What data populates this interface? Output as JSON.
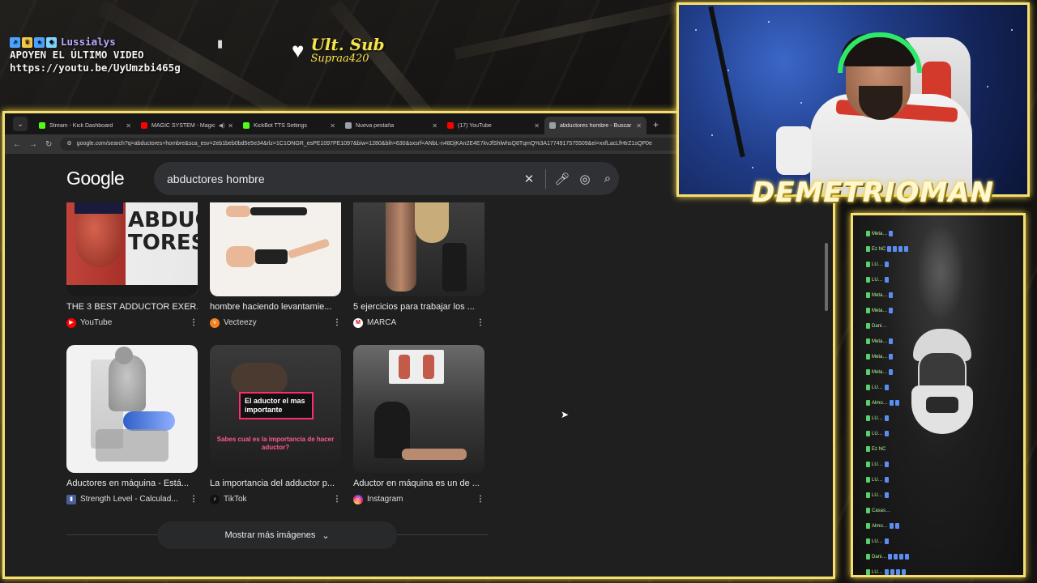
{
  "overlay": {
    "username": "Lussialys",
    "line1": "APOYEN EL ÚLTIMO VIDEO",
    "line2": "https://youtu.be/UyUmzbi465g",
    "sub_title": "Ult. Sub",
    "sub_name": "Supraa420"
  },
  "browser": {
    "tabs": [
      {
        "label": "Stream - Kick Dashboard",
        "color": "#53fc18"
      },
      {
        "label": "MAGIC SYSTEM - Magic In",
        "color": "#ff0000"
      },
      {
        "label": "KickBot TTS Settings",
        "color": "#53fc18"
      },
      {
        "label": "Nueva pestaña",
        "color": "#9aa0a6"
      },
      {
        "label": "(17) YouTube",
        "color": "#ff0000"
      },
      {
        "label": "abductores hombre - Buscar co",
        "color": "#9aa0a6"
      }
    ],
    "url": "google.com/search?q=abductores+hombre&sca_esv=2eb1beb0bd5e5e34&rlz=1C1ONGR_esPE1097PE1097&biw=1280&bih=630&sxsrf=ANbL-n48DjKAn2E4E7kvJfShlwhsQ8TqmQ%3A1774917575509&ei=xxfLacLfHtrZ1sQP0e"
  },
  "google": {
    "logo": "Google",
    "query": "abductores hombre",
    "results": [
      {
        "title": "THE 3 BEST ADDUCTOR EXER...",
        "source": "YouTube",
        "src_color": "#ff0000"
      },
      {
        "title": "hombre haciendo levantamie...",
        "source": "Vecteezy",
        "src_color": "#f58220"
      },
      {
        "title": "5 ejercicios para trabajar los ...",
        "source": "MARCA",
        "src_color": "#d0021b"
      },
      {
        "title": "Aductores en máquina - Está...",
        "source": "Strength Level - Calculad...",
        "src_color": "#4a5f9a"
      },
      {
        "title": "La importancia del adductor p...",
        "source": "TikTok",
        "src_color": "#111111"
      },
      {
        "title": "Aductor en máquina es un de ...",
        "source": "Instagram",
        "src_color": "#d6249f"
      }
    ],
    "thumb_text": {
      "yt_overlay_1": "ABDUC",
      "yt_overlay_2": "TORES",
      "tiktok_caption": "El aductor el mas importante",
      "tiktok_sub": "Sabes cual es la importancia de hacer aductor?"
    },
    "more_images": "Mostrar más imágenes"
  },
  "stream": {
    "streamer_name": "DEMETRIOMAN"
  },
  "chat": {
    "lines": [
      {
        "name": "Meta…",
        "dots": 1
      },
      {
        "name": "Ez NC",
        "dots": 4
      },
      {
        "name": "LU…",
        "dots": 1
      },
      {
        "name": "LU…",
        "dots": 1
      },
      {
        "name": "Meta…",
        "dots": 1
      },
      {
        "name": "Meta…",
        "dots": 1
      },
      {
        "name": "Dani…",
        "dots": 0
      },
      {
        "name": "Meta…",
        "dots": 1
      },
      {
        "name": "Meta…",
        "dots": 1
      },
      {
        "name": "Meta…",
        "dots": 1
      },
      {
        "name": "LU…",
        "dots": 1
      },
      {
        "name": "Almo…",
        "dots": 2
      },
      {
        "name": "LU…",
        "dots": 1
      },
      {
        "name": "LU…",
        "dots": 1
      },
      {
        "name": "Ez NC",
        "dots": 0
      },
      {
        "name": "LU…",
        "dots": 1
      },
      {
        "name": "LU…",
        "dots": 1
      },
      {
        "name": "LU…",
        "dots": 1
      },
      {
        "name": "Casas…",
        "dots": 0
      },
      {
        "name": "Almo…",
        "dots": 2
      },
      {
        "name": "LU…",
        "dots": 1
      },
      {
        "name": "Dani…",
        "dots": 4
      },
      {
        "name": "LU…",
        "dots": 4
      }
    ]
  }
}
